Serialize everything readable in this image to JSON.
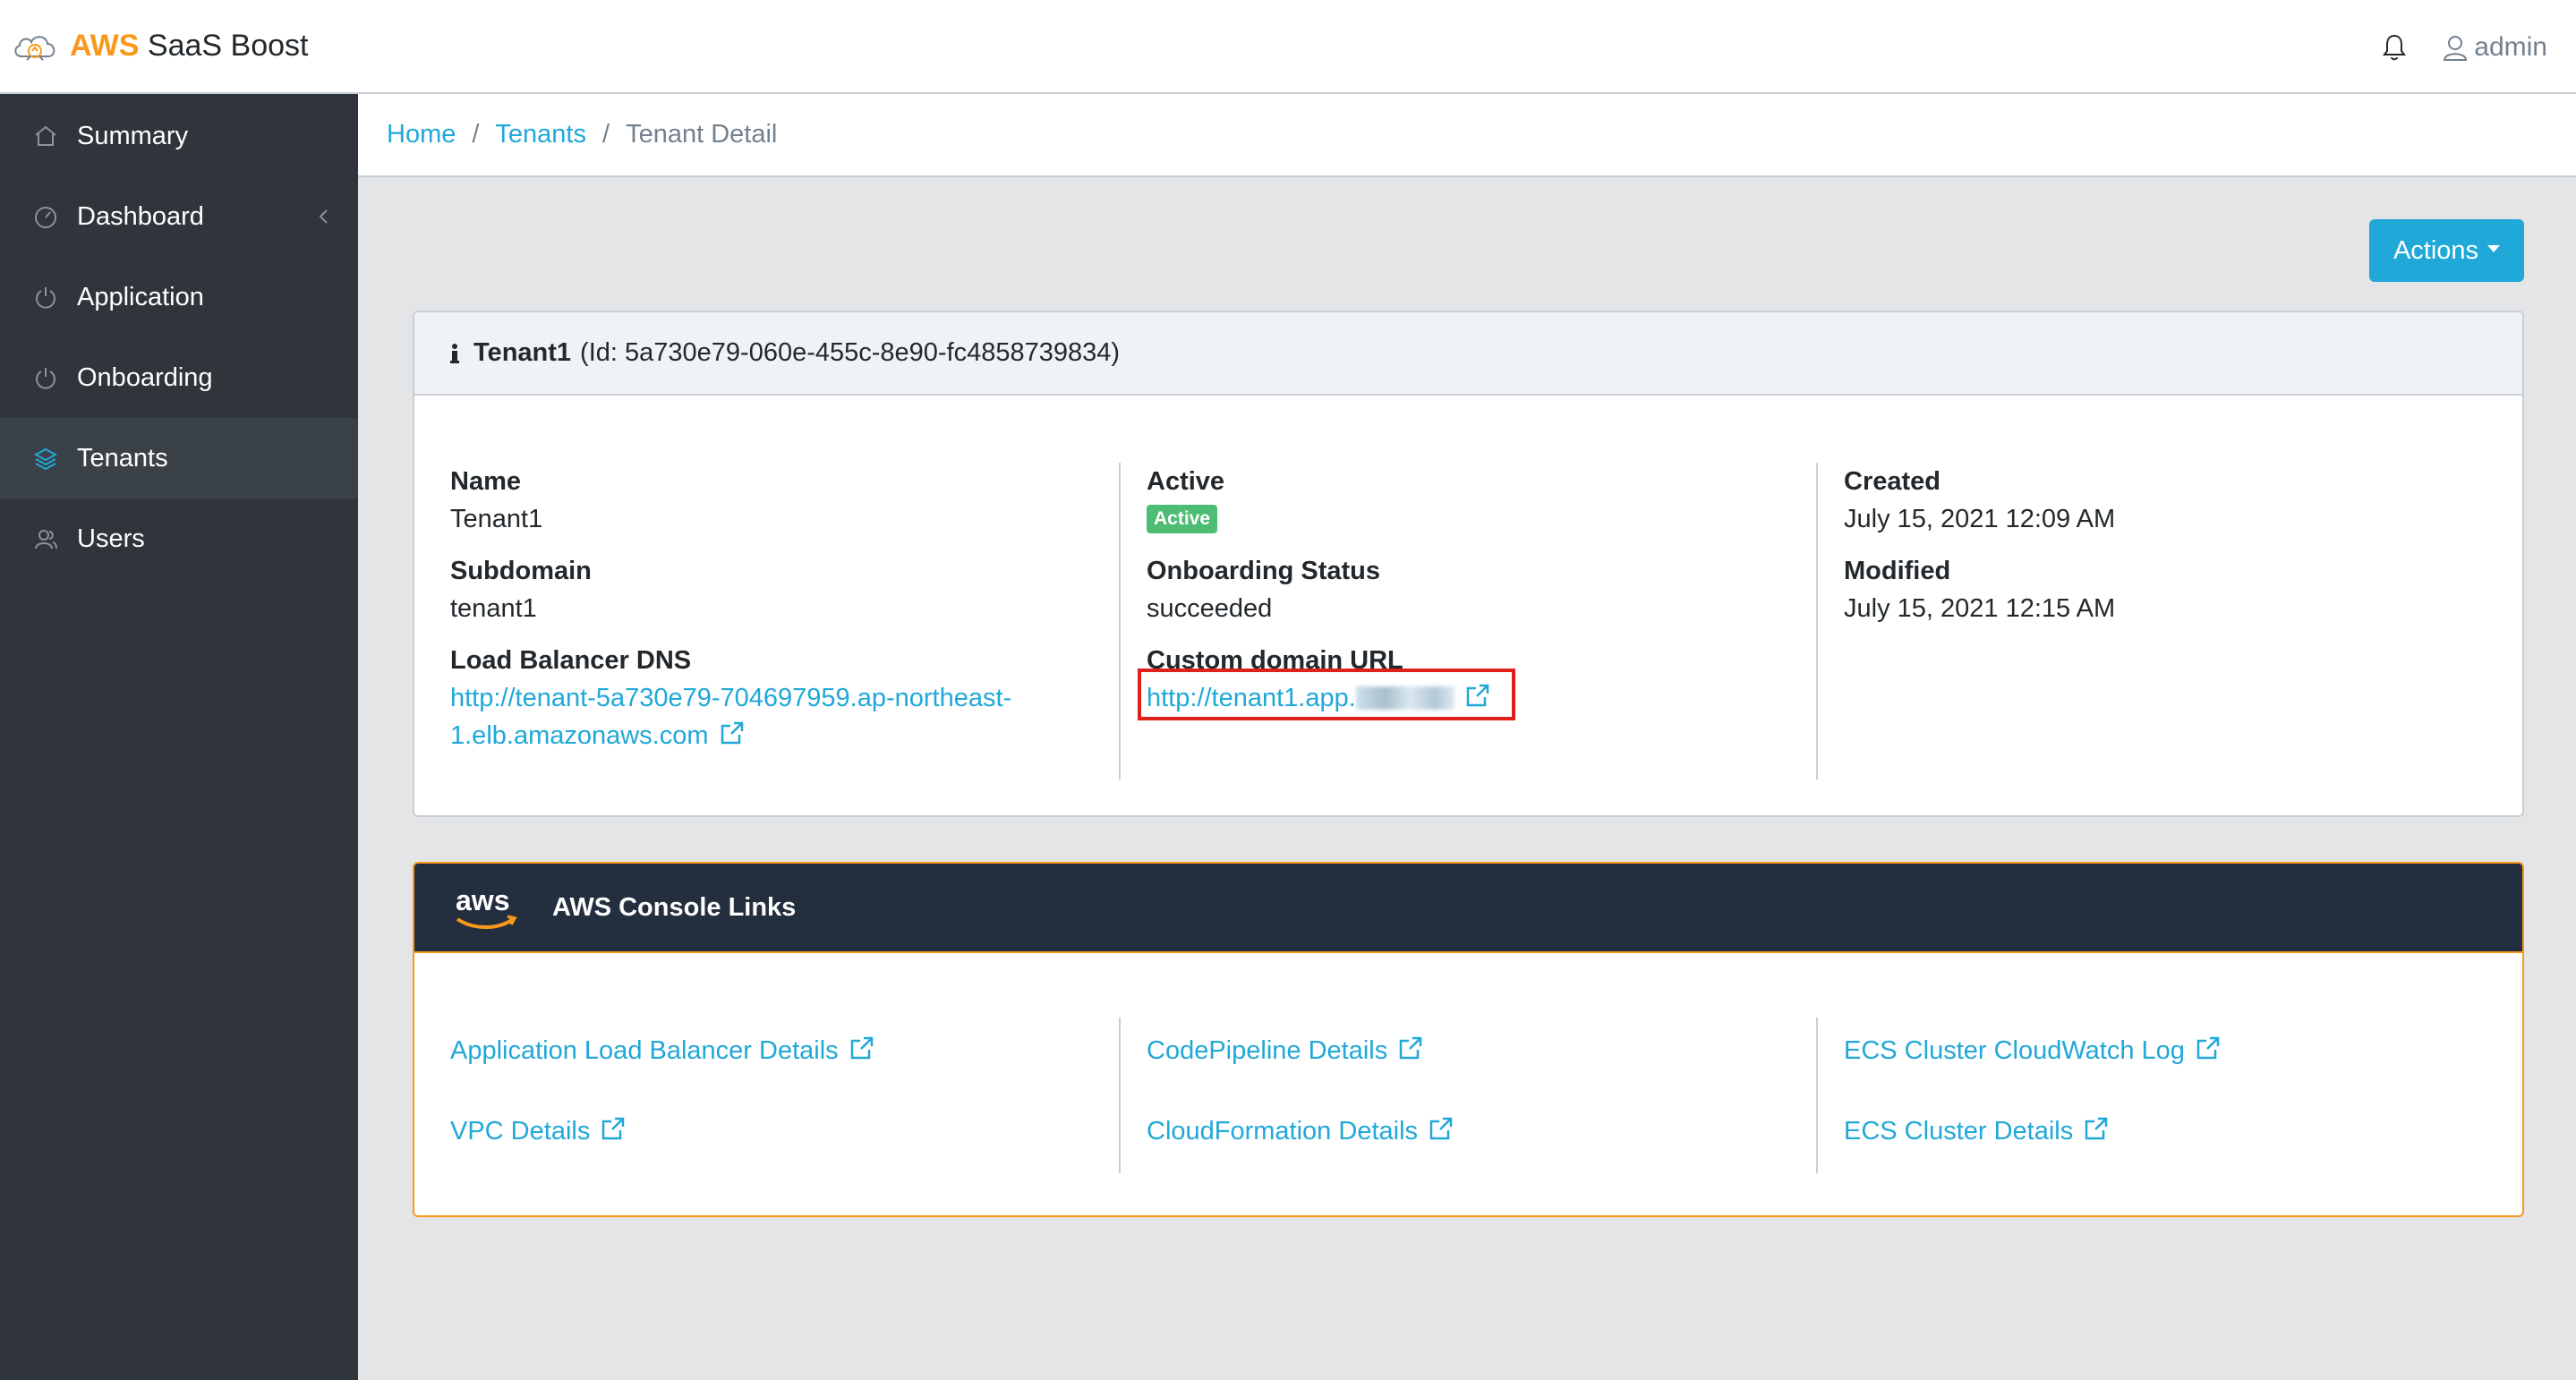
{
  "app": {
    "brand_aws": "AWS",
    "brand_rest": " SaaS Boost",
    "user": "admin"
  },
  "colors": {
    "accent": "#20a8d8",
    "brand_orange": "#f8991c",
    "sidebar": "#2f353a",
    "badge_success": "#4dbd74",
    "highlight": "#e0201b"
  },
  "sidebar": {
    "items": [
      {
        "label": "Summary",
        "icon": "home-icon"
      },
      {
        "label": "Dashboard",
        "icon": "speedometer-icon"
      },
      {
        "label": "Application",
        "icon": "power-icon"
      },
      {
        "label": "Onboarding",
        "icon": "power-icon"
      },
      {
        "label": "Tenants",
        "icon": "layers-icon"
      },
      {
        "label": "Users",
        "icon": "users-icon"
      }
    ]
  },
  "breadcrumb": {
    "home": "Home",
    "tenants": "Tenants",
    "current": "Tenant Detail",
    "separator": "/"
  },
  "actions": {
    "label": "Actions"
  },
  "tenant_card": {
    "name_bold": "Tenant1",
    "id_text": "(Id: 5a730e79-060e-455c-8e90-fc4858739834)",
    "col1": {
      "name_label": "Name",
      "name_value": "Tenant1",
      "subdomain_label": "Subdomain",
      "subdomain_value": "tenant1",
      "lb_label": "Load Balancer DNS",
      "lb_line1": "http://tenant-5a730e79-704697959.ap-northeast-",
      "lb_line2": "1.elb.amazonaws.com"
    },
    "col2": {
      "active_label": "Active",
      "active_badge": "Active",
      "status_label": "Onboarding Status",
      "status_value": "succeeded",
      "custom_label": "Custom domain URL",
      "custom_url": "http://tenant1.app."
    },
    "col3": {
      "created_label": "Created",
      "created_value": "July 15, 2021 12:09 AM",
      "modified_label": "Modified",
      "modified_value": "July 15, 2021 12:15 AM"
    }
  },
  "aws_card": {
    "logo": "aws",
    "title": "AWS Console Links",
    "links": [
      "Application Load Balancer Details",
      "VPC Details",
      "CodePipeline Details",
      "CloudFormation Details",
      "ECS Cluster CloudWatch Log",
      "ECS Cluster Details"
    ]
  }
}
